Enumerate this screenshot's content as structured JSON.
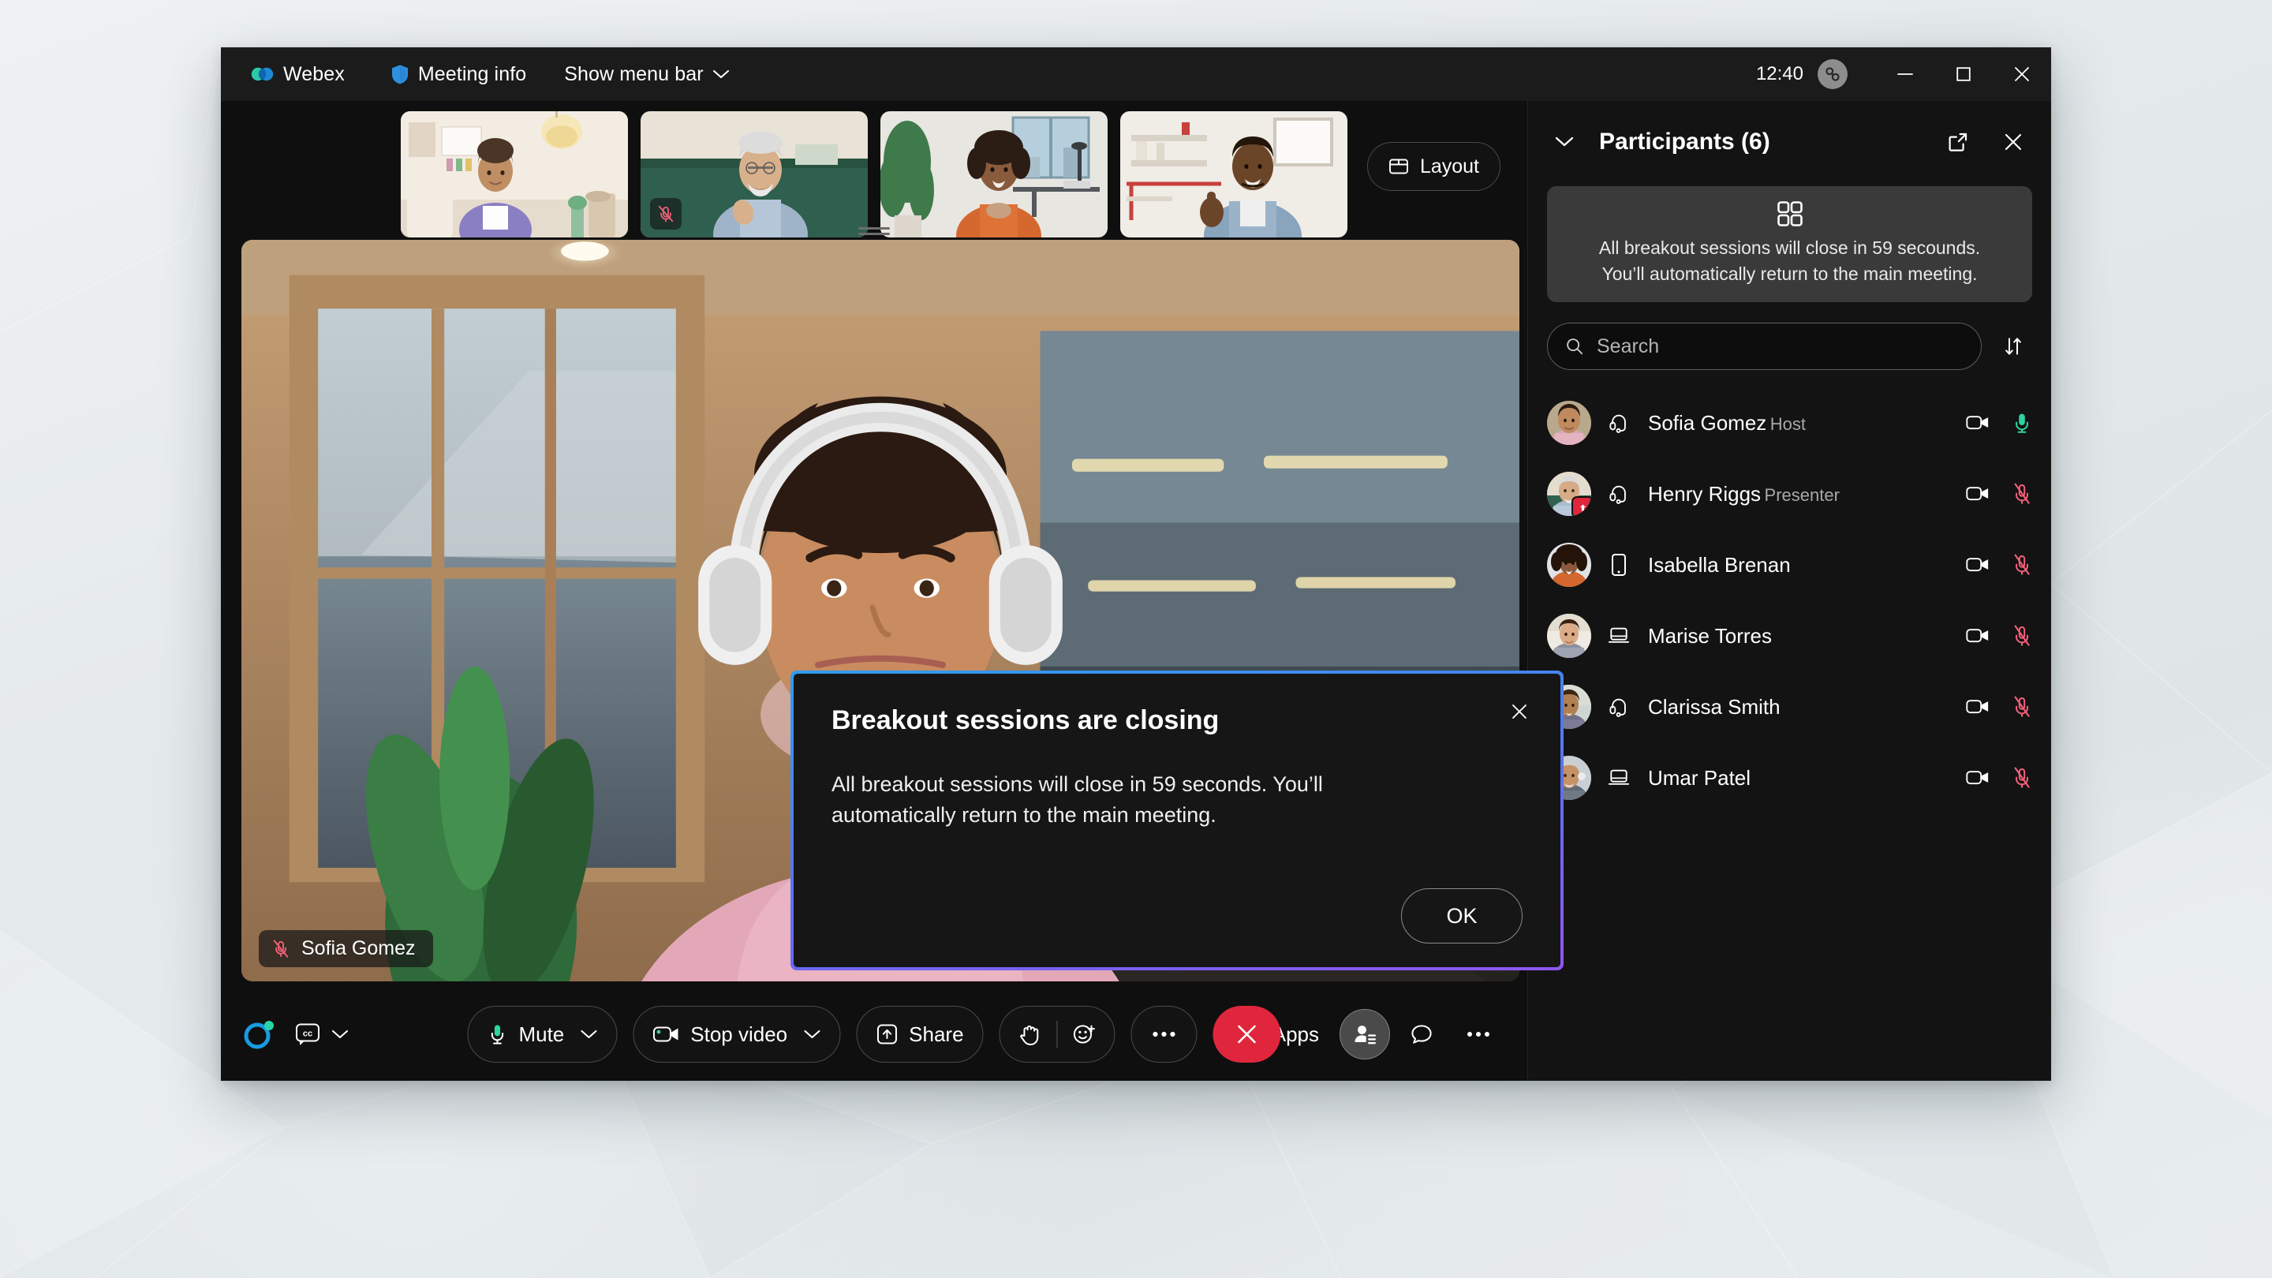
{
  "titlebar": {
    "app_name": "Webex",
    "meeting_info": "Meeting info",
    "show_menu_bar": "Show menu bar",
    "time": "12:40",
    "minimize_label": "Minimize",
    "maximize_label": "Maximize",
    "close_label": "Close"
  },
  "stage": {
    "layout_label": "Layout",
    "active_speaker_name": "Sofia Gomez",
    "thumbnails": [
      {
        "name": "participant-1",
        "muted": false
      },
      {
        "name": "participant-2",
        "muted": true
      },
      {
        "name": "participant-3",
        "muted": false
      },
      {
        "name": "participant-4",
        "muted": false
      }
    ]
  },
  "controls": {
    "captions_label": "cc",
    "mute_label": "Mute",
    "stop_video_label": "Stop video",
    "share_label": "Share",
    "more_label": "…",
    "end_label": "End meeting",
    "apps_label": "Apps",
    "participants_label": "Participants",
    "chat_label": "Chat",
    "more_options_label": "…"
  },
  "panel": {
    "title": "Participants (6)",
    "collapse_label": "Collapse panel",
    "popout_label": "Open in new window",
    "close_label": "Close panel",
    "banner_line1": "All breakout sessions will close in 59 secounds.",
    "banner_line2": "You’ll automatically return to the main meeting.",
    "search_placeholder": "Search",
    "search_value": "",
    "sort_label": "Sort",
    "participants": [
      {
        "name": "Sofia Gomez",
        "role": "Host",
        "device": "headset",
        "muted": false,
        "video_on": true,
        "presenter": false
      },
      {
        "name": "Henry Riggs",
        "role": "Presenter",
        "device": "headset",
        "muted": true,
        "video_on": true,
        "presenter": true
      },
      {
        "name": "Isabella Brenan",
        "role": "",
        "device": "phone",
        "muted": true,
        "video_on": true,
        "presenter": false
      },
      {
        "name": "Marise Torres",
        "role": "",
        "device": "laptop",
        "muted": true,
        "video_on": true,
        "presenter": false
      },
      {
        "name": "Clarissa Smith",
        "role": "",
        "device": "headset",
        "muted": true,
        "video_on": true,
        "presenter": false
      },
      {
        "name": "Umar Patel",
        "role": "",
        "device": "laptop",
        "muted": true,
        "video_on": true,
        "presenter": false
      }
    ]
  },
  "modal": {
    "title": "Breakout sessions are closing",
    "body": "All breakout sessions will close in 59 seconds. You’ll automatically return to the main meeting.",
    "ok_label": "OK",
    "close_label": "Close"
  },
  "colors": {
    "accent_blue": "#2f9dee",
    "accent_purple": "#8f56f2",
    "mic_on_green": "#2ed3a0",
    "mic_off_red": "#f4607a",
    "end_red": "#e0263c",
    "panel_bg": "#131313",
    "window_bg": "#0f0f0f"
  }
}
